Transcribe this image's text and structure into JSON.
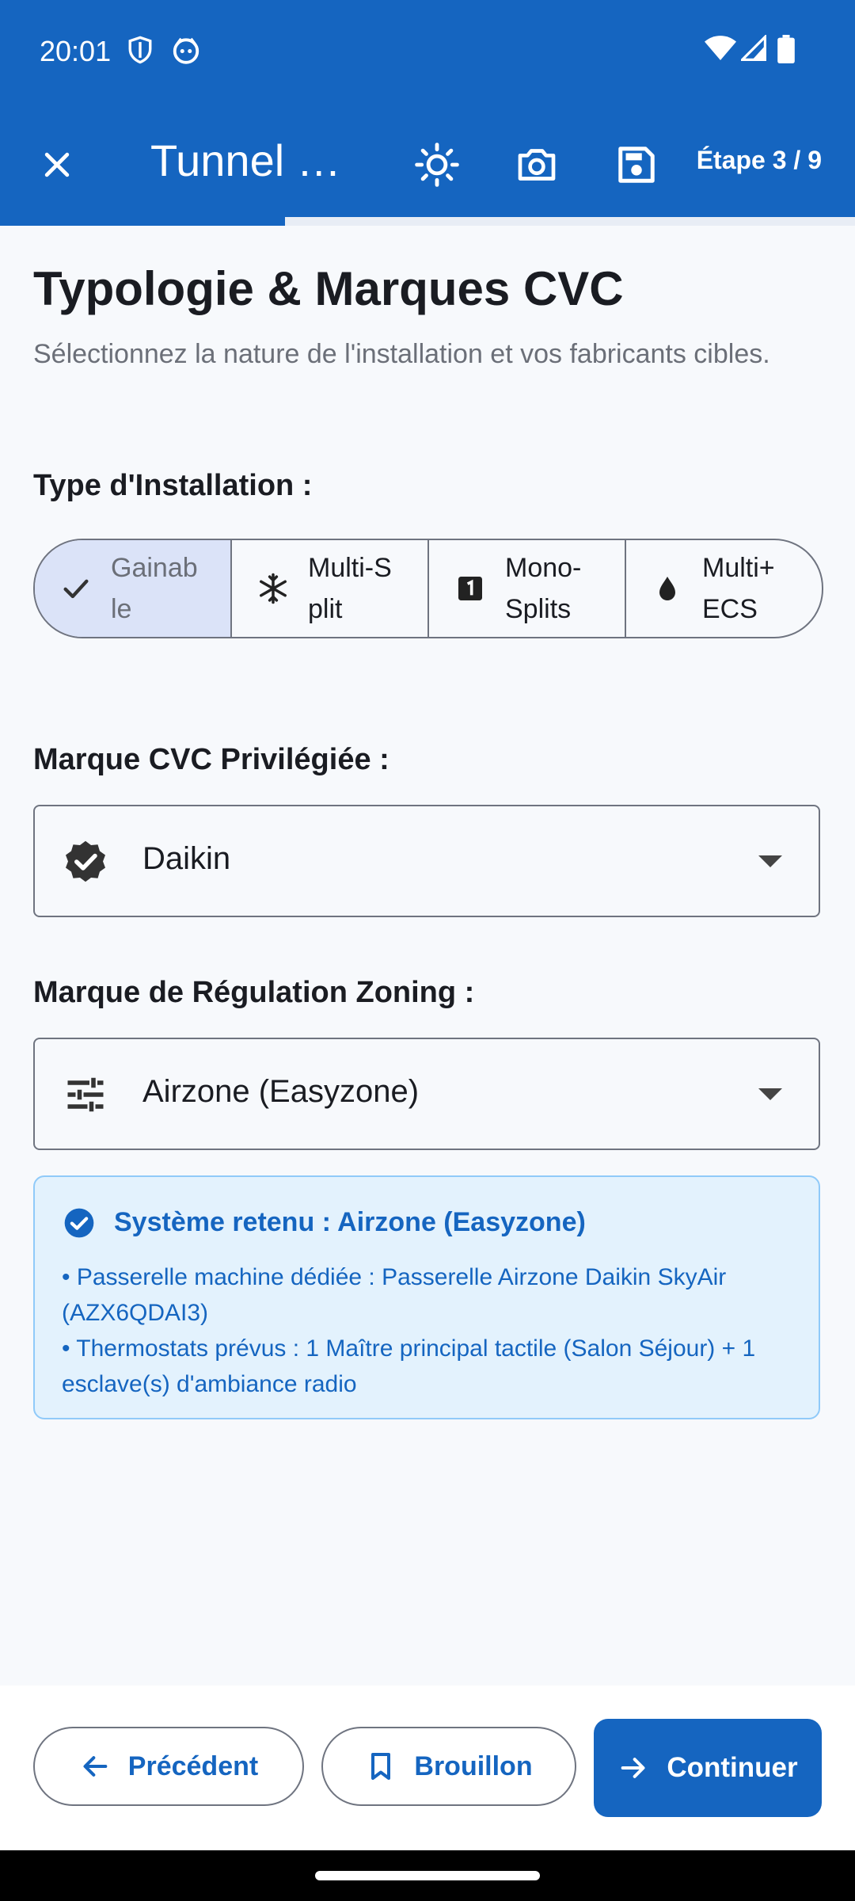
{
  "status_bar": {
    "time": "20:01"
  },
  "toolbar": {
    "title": "Tunnel d…",
    "step": "Étape 3 / 9",
    "progress": 0.333
  },
  "page": {
    "title": "Typologie & Marques CVC",
    "subtitle": "Sélectionnez la nature de l'installation et vos fabricants cibles."
  },
  "installation": {
    "label": "Type d'Installation :",
    "options": [
      {
        "label": "Gainable",
        "icon": "check-icon",
        "selected": true
      },
      {
        "label": "Multi-Split",
        "icon": "snowflake-icon",
        "selected": false
      },
      {
        "label": "Mono-Splits",
        "icon": "number-one-box-icon",
        "selected": false
      },
      {
        "label": "Multi+ ECS",
        "icon": "water-drop-icon",
        "selected": false
      }
    ]
  },
  "brand": {
    "label": "Marque CVC Privilégiée :",
    "value": "Daikin",
    "icon": "verified-badge-icon"
  },
  "zoning": {
    "label": "Marque de Régulation Zoning :",
    "value": "Airzone (Easyzone)",
    "icon": "tune-icon"
  },
  "info": {
    "heading": "Système retenu : Airzone (Easyzone)",
    "lines": [
      "• Passerelle machine dédiée : Passerelle Airzone Daikin SkyAir (AZX6QDAI3)",
      "• Thermostats prévus : 1 Maître principal tactile (Salon Séjour) + 1 esclave(s) d'ambiance radio"
    ]
  },
  "actions": {
    "previous": "Précédent",
    "draft": "Brouillon",
    "continue": "Continuer"
  },
  "colors": {
    "primary": "#1565c0",
    "selected_bg": "#dbe3f8",
    "info_bg": "#e3f2fd"
  }
}
